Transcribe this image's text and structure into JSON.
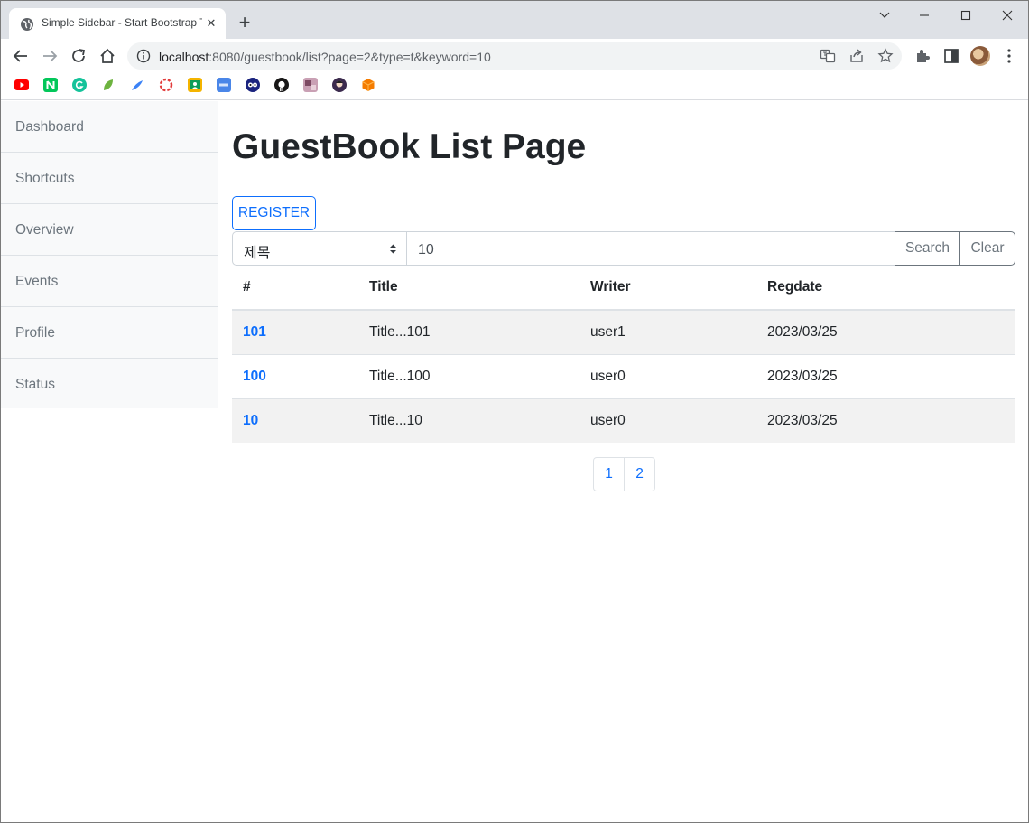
{
  "browser": {
    "tab_title": "Simple Sidebar - Start Bootstrap Template",
    "url_host": "localhost",
    "url_rest": ":8080/guestbook/list?page=2&type=t&keyword=10"
  },
  "sidebar": {
    "items": [
      {
        "label": "Dashboard"
      },
      {
        "label": "Shortcuts"
      },
      {
        "label": "Overview"
      },
      {
        "label": "Events"
      },
      {
        "label": "Profile"
      },
      {
        "label": "Status"
      }
    ]
  },
  "main": {
    "title": "GuestBook List Page",
    "register_label": "REGISTER",
    "search": {
      "type_selected": "제목",
      "keyword_value": "10",
      "search_label": "Search",
      "clear_label": "Clear"
    },
    "table": {
      "headers": [
        "#",
        "Title",
        "Writer",
        "Regdate"
      ],
      "rows": [
        {
          "gno": "101",
          "title": "Title...101",
          "writer": "user1",
          "regdate": "2023/03/25"
        },
        {
          "gno": "100",
          "title": "Title...100",
          "writer": "user0",
          "regdate": "2023/03/25"
        },
        {
          "gno": "10",
          "title": "Title...10",
          "writer": "user0",
          "regdate": "2023/03/25"
        }
      ]
    },
    "pagination": [
      "1",
      "2"
    ]
  },
  "colors": {
    "primary": "#0d6efd",
    "secondary": "#6c757d",
    "sidebar_bg": "#f8f9fa",
    "stripe_bg": "#f2f2f2"
  }
}
